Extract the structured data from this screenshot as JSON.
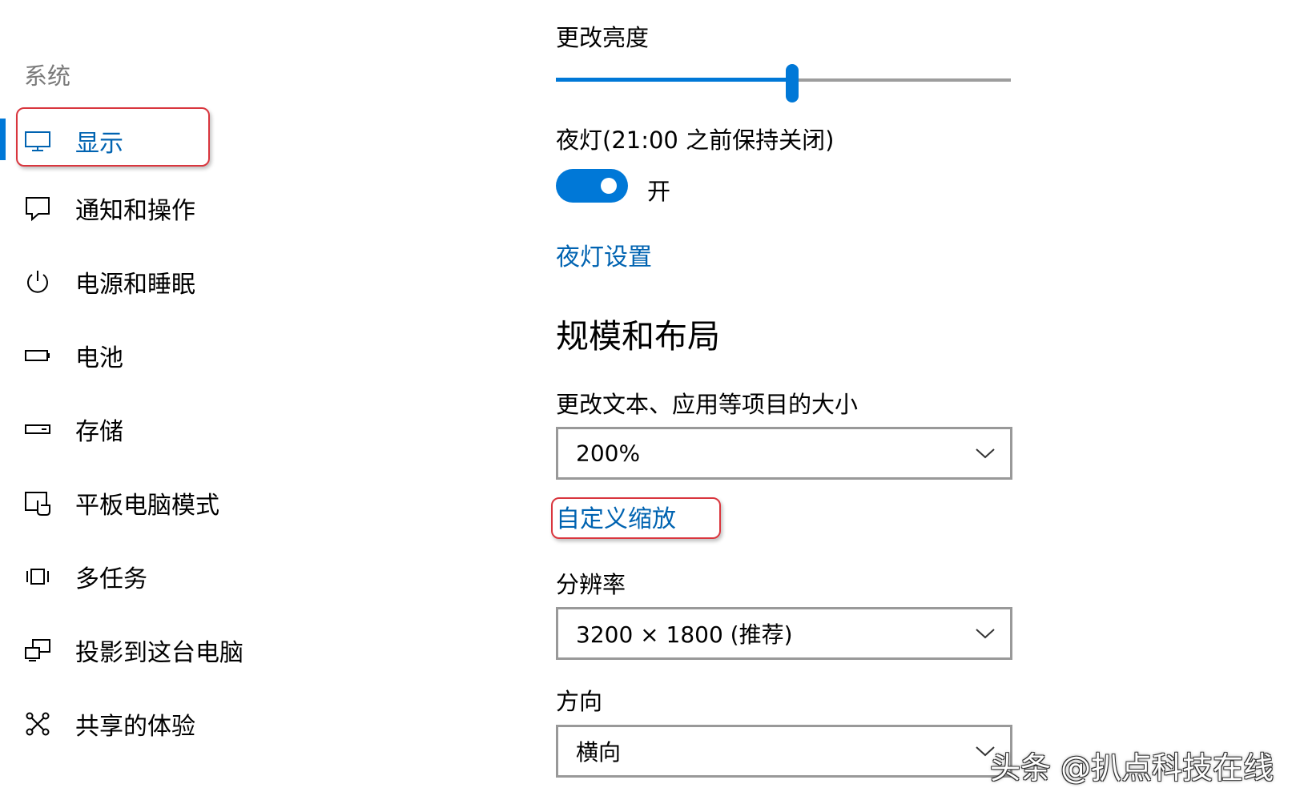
{
  "sidebar": {
    "heading": "系统",
    "items": [
      {
        "label": "显示",
        "icon": "monitor-icon",
        "active": true
      },
      {
        "label": "通知和操作",
        "icon": "notification-icon"
      },
      {
        "label": "电源和睡眠",
        "icon": "power-icon"
      },
      {
        "label": "电池",
        "icon": "battery-icon"
      },
      {
        "label": "存储",
        "icon": "storage-icon"
      },
      {
        "label": "平板电脑模式",
        "icon": "tablet-mode-icon"
      },
      {
        "label": "多任务",
        "icon": "multitasking-icon"
      },
      {
        "label": "投影到这台电脑",
        "icon": "projecting-icon"
      },
      {
        "label": "共享的体验",
        "icon": "shared-experiences-icon"
      }
    ]
  },
  "main": {
    "brightness": {
      "label": "更改亮度",
      "level_percent": 52
    },
    "night_light": {
      "label": "夜灯(21:00 之前保持关闭)",
      "toggle_state": "开",
      "on": true
    },
    "night_light_settings_link": "夜灯设置",
    "scale_section_title": "规模和布局",
    "scale": {
      "label": "更改文本、应用等项目的大小",
      "value": "200%"
    },
    "custom_scaling_link": "自定义缩放",
    "resolution": {
      "label": "分辨率",
      "value": "3200 × 1800 (推荐)"
    },
    "orientation": {
      "label": "方向",
      "value": "横向"
    }
  },
  "watermark": "头条 @扒点科技在线",
  "colors": {
    "accent": "#0078d7",
    "link": "#0063b1",
    "highlight": "#d9363e"
  }
}
